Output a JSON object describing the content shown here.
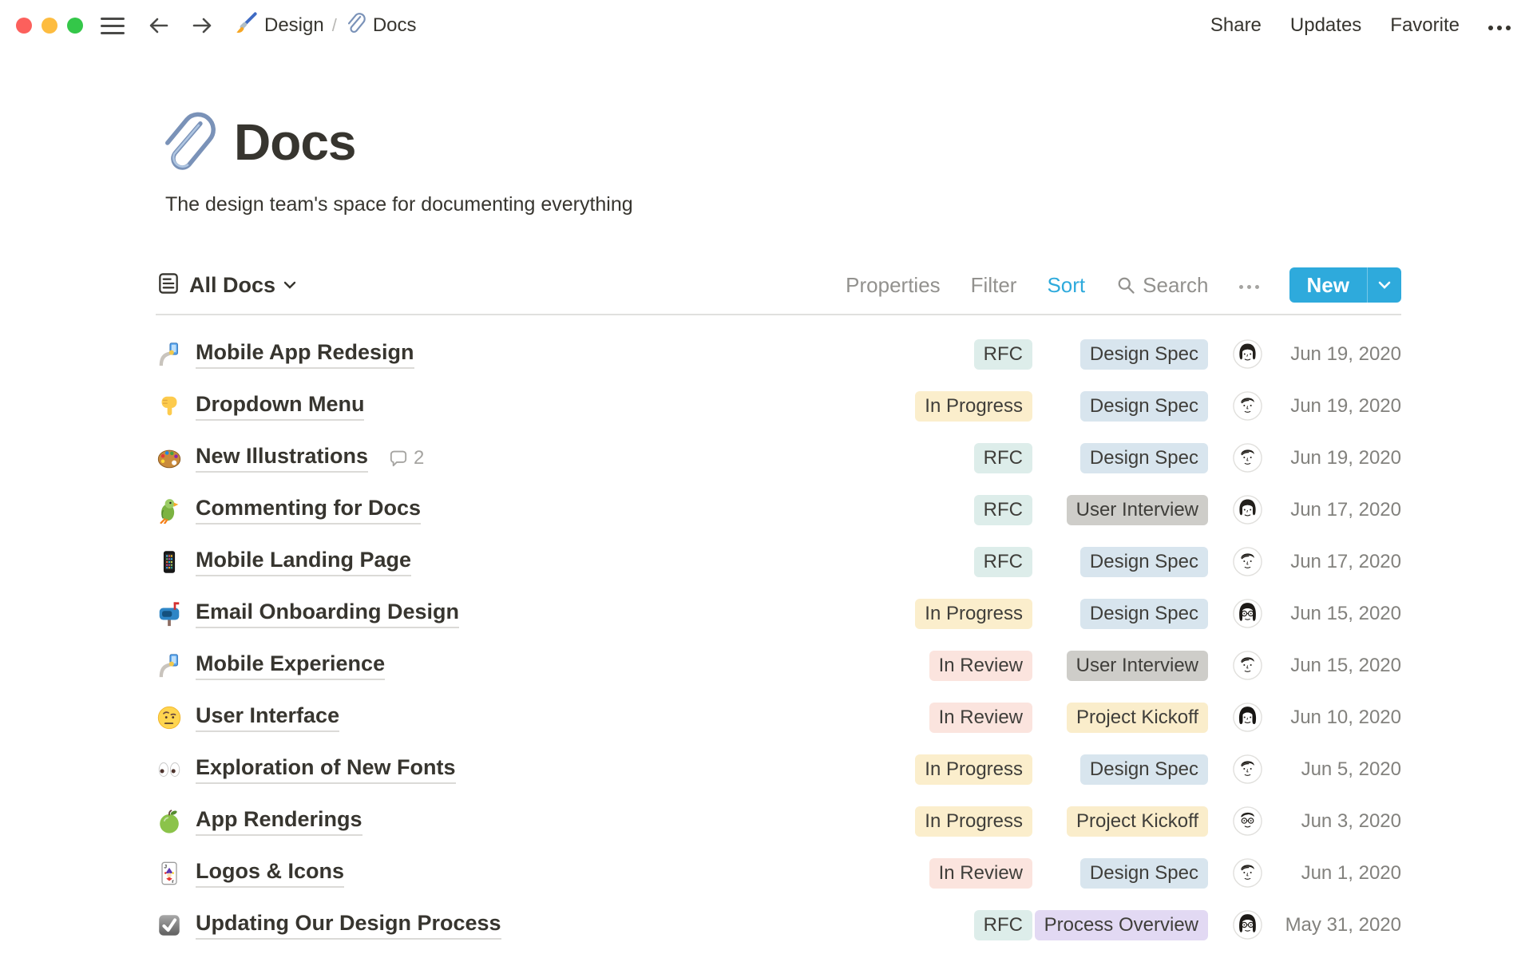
{
  "window": {
    "breadcrumb": [
      {
        "icon": "paintbrush",
        "label": "Design"
      },
      {
        "icon": "paperclip",
        "label": "Docs"
      }
    ],
    "separator": "/",
    "actions": {
      "share": "Share",
      "updates": "Updates",
      "favorite": "Favorite"
    }
  },
  "page": {
    "icon": "paperclip",
    "title": "Docs",
    "subtitle": "The design team's space for documenting everything"
  },
  "toolbar": {
    "view_label": "All Docs",
    "properties_label": "Properties",
    "filter_label": "Filter",
    "sort_label": "Sort",
    "active_tool": "Sort",
    "search_label": "Search",
    "new_label": "New"
  },
  "colors": {
    "accent": "#2EAADC",
    "status_colors": {
      "RFC": "#DDEDEA",
      "In Progress": "#FBEECC",
      "In Review": "#FBE4DE"
    },
    "type_colors": {
      "Design Spec": "#D8E5EE",
      "User Interview": "#CECDC9",
      "Project Kickoff": "#FAEDCB",
      "Process Overview": "#E2D9F3"
    }
  },
  "table": {
    "rows": [
      {
        "icon": "selfie",
        "title": "Mobile App Redesign",
        "comments": null,
        "status": "RFC",
        "type": "Design Spec",
        "avatar": "woman1",
        "date": "Jun 19, 2020"
      },
      {
        "icon": "pointdown",
        "title": "Dropdown Menu",
        "comments": null,
        "status": "In Progress",
        "type": "Design Spec",
        "avatar": "man1",
        "date": "Jun 19, 2020"
      },
      {
        "icon": "palette",
        "title": "New Illustrations",
        "comments": "2",
        "status": "RFC",
        "type": "Design Spec",
        "avatar": "man1",
        "date": "Jun 19, 2020"
      },
      {
        "icon": "parrot",
        "title": "Commenting for Docs",
        "comments": null,
        "status": "RFC",
        "type": "User Interview",
        "avatar": "woman1",
        "date": "Jun 17, 2020"
      },
      {
        "icon": "iphone",
        "title": "Mobile Landing Page",
        "comments": null,
        "status": "RFC",
        "type": "Design Spec",
        "avatar": "man1",
        "date": "Jun 17, 2020"
      },
      {
        "icon": "mailbox",
        "title": "Email Onboarding Design",
        "comments": null,
        "status": "In Progress",
        "type": "Design Spec",
        "avatar": "glasses1",
        "date": "Jun 15, 2020"
      },
      {
        "icon": "selfie",
        "title": "Mobile Experience",
        "comments": null,
        "status": "In Review",
        "type": "User Interview",
        "avatar": "man1",
        "date": "Jun 15, 2020"
      },
      {
        "icon": "eyebrow",
        "title": "User Interface",
        "comments": null,
        "status": "In Review",
        "type": "Project Kickoff",
        "avatar": "woman2",
        "date": "Jun 10, 2020"
      },
      {
        "icon": "eyes",
        "title": "Exploration of New Fonts",
        "comments": null,
        "status": "In Progress",
        "type": "Design Spec",
        "avatar": "man1",
        "date": "Jun 5, 2020"
      },
      {
        "icon": "apple",
        "title": "App Renderings",
        "comments": null,
        "status": "In Progress",
        "type": "Project Kickoff",
        "avatar": "manglasses",
        "date": "Jun 3, 2020"
      },
      {
        "icon": "joker",
        "title": "Logos & Icons",
        "comments": null,
        "status": "In Review",
        "type": "Design Spec",
        "avatar": "man1",
        "date": "Jun 1, 2020"
      },
      {
        "icon": "checkmark",
        "title": "Updating Our Design Process",
        "comments": null,
        "status": "RFC",
        "type": "Process Overview",
        "avatar": "glasses1",
        "date": "May 31, 2020"
      }
    ]
  }
}
